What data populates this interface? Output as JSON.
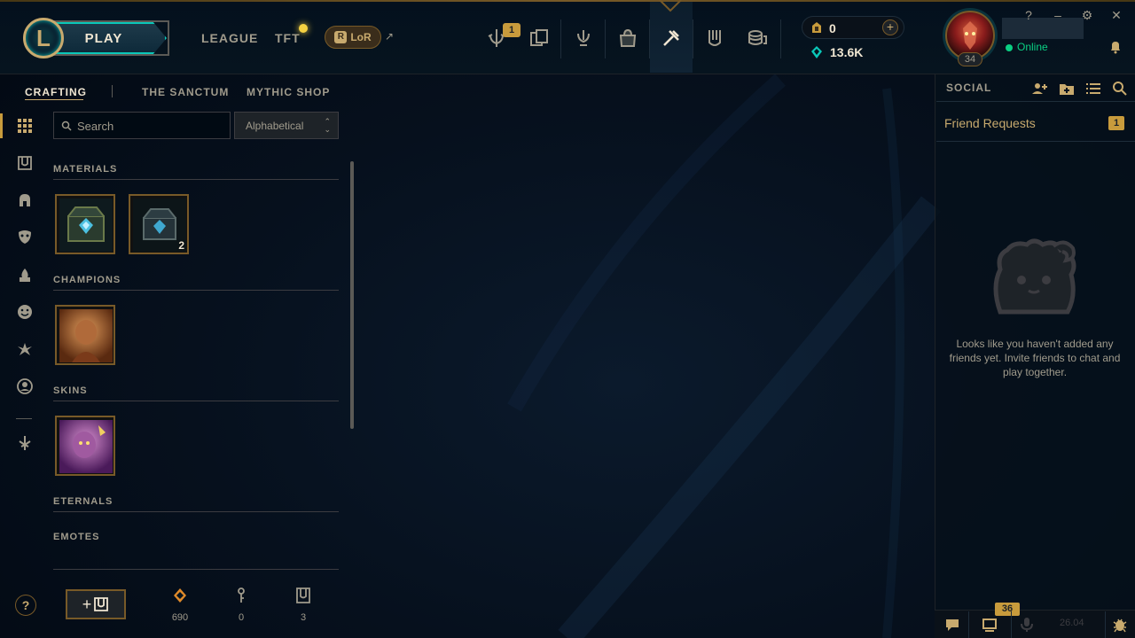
{
  "topnav": {
    "play_label": "PLAY",
    "links": [
      "LEAGUE",
      "TFT"
    ],
    "lor_label": "LoR",
    "lor_badge": "R",
    "external_icon": "↗",
    "icons": [
      "missions-icon",
      "collection-cards-icon",
      "challenges-icon",
      "store-bag-icon",
      "loot-crafting-icon",
      "clash-icon",
      "currency-stack-icon"
    ],
    "missions_badge": "1",
    "currency": {
      "blue_essence_like": "0",
      "orange_essence_like": "13.6K"
    },
    "add_label": "+",
    "window_controls": [
      "?",
      "–",
      "⚙",
      "✕"
    ],
    "profile": {
      "level": "34",
      "status": "Online"
    }
  },
  "loot": {
    "subnav": [
      "CRAFTING",
      "THE SANCTUM",
      "MYTHIC SHOP"
    ],
    "search_placeholder": "Search",
    "sort_value": "Alphabetical",
    "sort_arrows": "⌃⌄",
    "sections": {
      "materials": "MATERIALS",
      "champions": "CHAMPIONS",
      "skins": "SKINS",
      "eternals": "ETERNALS",
      "emotes": "EMOTES"
    },
    "materials_items": [
      {
        "name": "hextech-chest",
        "count": ""
      },
      {
        "name": "masterwork-chest",
        "count": "2"
      }
    ],
    "rail_icons": [
      "grid-icon",
      "chest-icon",
      "champion-helmet-icon",
      "skin-mask-icon",
      "ward-flame-icon",
      "emote-face-icon",
      "eternals-icon",
      "icon-profile-icon",
      "misc-icon"
    ],
    "footer": {
      "help": "?",
      "add_key_plus": "+",
      "orange_essence": "690",
      "keys": "0",
      "chests": "3"
    }
  },
  "social": {
    "title": "SOCIAL",
    "friend_requests_label": "Friend Requests",
    "friend_requests_count": "1",
    "empty_message": "Looks like you haven't added any friends yet. Invite friends to chat and play together.",
    "chat_count": "36",
    "version": "26.04"
  },
  "colors": {
    "gold": "#c8aa6e",
    "accent_gold": "#c89b3c",
    "teal": "#0ac8b9",
    "online": "#0acf83",
    "text_muted": "#a09b8c",
    "text_bright": "#f0e6d2"
  }
}
